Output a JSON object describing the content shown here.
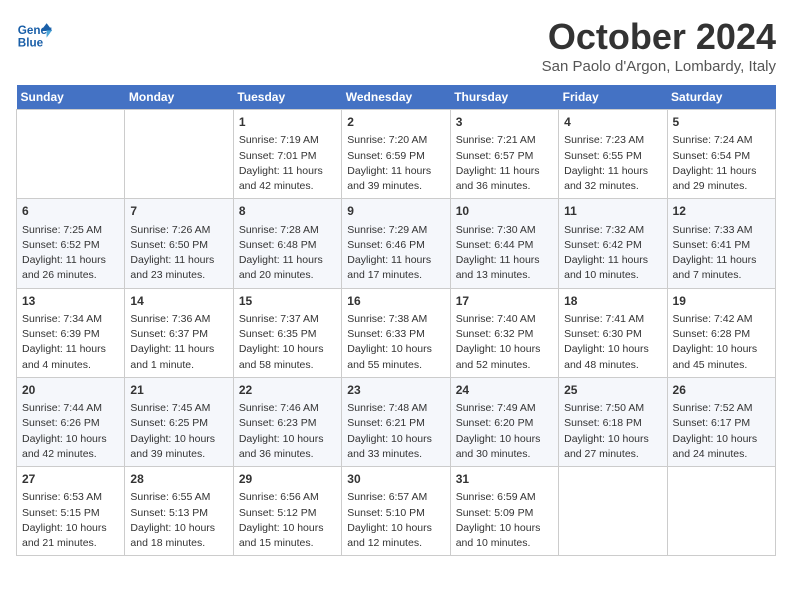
{
  "header": {
    "logo_line1": "General",
    "logo_line2": "Blue",
    "month": "October 2024",
    "location": "San Paolo d'Argon, Lombardy, Italy"
  },
  "weekdays": [
    "Sunday",
    "Monday",
    "Tuesday",
    "Wednesday",
    "Thursday",
    "Friday",
    "Saturday"
  ],
  "weeks": [
    [
      {
        "day": "",
        "sunrise": "",
        "sunset": "",
        "daylight": ""
      },
      {
        "day": "",
        "sunrise": "",
        "sunset": "",
        "daylight": ""
      },
      {
        "day": "1",
        "sunrise": "Sunrise: 7:19 AM",
        "sunset": "Sunset: 7:01 PM",
        "daylight": "Daylight: 11 hours and 42 minutes."
      },
      {
        "day": "2",
        "sunrise": "Sunrise: 7:20 AM",
        "sunset": "Sunset: 6:59 PM",
        "daylight": "Daylight: 11 hours and 39 minutes."
      },
      {
        "day": "3",
        "sunrise": "Sunrise: 7:21 AM",
        "sunset": "Sunset: 6:57 PM",
        "daylight": "Daylight: 11 hours and 36 minutes."
      },
      {
        "day": "4",
        "sunrise": "Sunrise: 7:23 AM",
        "sunset": "Sunset: 6:55 PM",
        "daylight": "Daylight: 11 hours and 32 minutes."
      },
      {
        "day": "5",
        "sunrise": "Sunrise: 7:24 AM",
        "sunset": "Sunset: 6:54 PM",
        "daylight": "Daylight: 11 hours and 29 minutes."
      }
    ],
    [
      {
        "day": "6",
        "sunrise": "Sunrise: 7:25 AM",
        "sunset": "Sunset: 6:52 PM",
        "daylight": "Daylight: 11 hours and 26 minutes."
      },
      {
        "day": "7",
        "sunrise": "Sunrise: 7:26 AM",
        "sunset": "Sunset: 6:50 PM",
        "daylight": "Daylight: 11 hours and 23 minutes."
      },
      {
        "day": "8",
        "sunrise": "Sunrise: 7:28 AM",
        "sunset": "Sunset: 6:48 PM",
        "daylight": "Daylight: 11 hours and 20 minutes."
      },
      {
        "day": "9",
        "sunrise": "Sunrise: 7:29 AM",
        "sunset": "Sunset: 6:46 PM",
        "daylight": "Daylight: 11 hours and 17 minutes."
      },
      {
        "day": "10",
        "sunrise": "Sunrise: 7:30 AM",
        "sunset": "Sunset: 6:44 PM",
        "daylight": "Daylight: 11 hours and 13 minutes."
      },
      {
        "day": "11",
        "sunrise": "Sunrise: 7:32 AM",
        "sunset": "Sunset: 6:42 PM",
        "daylight": "Daylight: 11 hours and 10 minutes."
      },
      {
        "day": "12",
        "sunrise": "Sunrise: 7:33 AM",
        "sunset": "Sunset: 6:41 PM",
        "daylight": "Daylight: 11 hours and 7 minutes."
      }
    ],
    [
      {
        "day": "13",
        "sunrise": "Sunrise: 7:34 AM",
        "sunset": "Sunset: 6:39 PM",
        "daylight": "Daylight: 11 hours and 4 minutes."
      },
      {
        "day": "14",
        "sunrise": "Sunrise: 7:36 AM",
        "sunset": "Sunset: 6:37 PM",
        "daylight": "Daylight: 11 hours and 1 minute."
      },
      {
        "day": "15",
        "sunrise": "Sunrise: 7:37 AM",
        "sunset": "Sunset: 6:35 PM",
        "daylight": "Daylight: 10 hours and 58 minutes."
      },
      {
        "day": "16",
        "sunrise": "Sunrise: 7:38 AM",
        "sunset": "Sunset: 6:33 PM",
        "daylight": "Daylight: 10 hours and 55 minutes."
      },
      {
        "day": "17",
        "sunrise": "Sunrise: 7:40 AM",
        "sunset": "Sunset: 6:32 PM",
        "daylight": "Daylight: 10 hours and 52 minutes."
      },
      {
        "day": "18",
        "sunrise": "Sunrise: 7:41 AM",
        "sunset": "Sunset: 6:30 PM",
        "daylight": "Daylight: 10 hours and 48 minutes."
      },
      {
        "day": "19",
        "sunrise": "Sunrise: 7:42 AM",
        "sunset": "Sunset: 6:28 PM",
        "daylight": "Daylight: 10 hours and 45 minutes."
      }
    ],
    [
      {
        "day": "20",
        "sunrise": "Sunrise: 7:44 AM",
        "sunset": "Sunset: 6:26 PM",
        "daylight": "Daylight: 10 hours and 42 minutes."
      },
      {
        "day": "21",
        "sunrise": "Sunrise: 7:45 AM",
        "sunset": "Sunset: 6:25 PM",
        "daylight": "Daylight: 10 hours and 39 minutes."
      },
      {
        "day": "22",
        "sunrise": "Sunrise: 7:46 AM",
        "sunset": "Sunset: 6:23 PM",
        "daylight": "Daylight: 10 hours and 36 minutes."
      },
      {
        "day": "23",
        "sunrise": "Sunrise: 7:48 AM",
        "sunset": "Sunset: 6:21 PM",
        "daylight": "Daylight: 10 hours and 33 minutes."
      },
      {
        "day": "24",
        "sunrise": "Sunrise: 7:49 AM",
        "sunset": "Sunset: 6:20 PM",
        "daylight": "Daylight: 10 hours and 30 minutes."
      },
      {
        "day": "25",
        "sunrise": "Sunrise: 7:50 AM",
        "sunset": "Sunset: 6:18 PM",
        "daylight": "Daylight: 10 hours and 27 minutes."
      },
      {
        "day": "26",
        "sunrise": "Sunrise: 7:52 AM",
        "sunset": "Sunset: 6:17 PM",
        "daylight": "Daylight: 10 hours and 24 minutes."
      }
    ],
    [
      {
        "day": "27",
        "sunrise": "Sunrise: 6:53 AM",
        "sunset": "Sunset: 5:15 PM",
        "daylight": "Daylight: 10 hours and 21 minutes."
      },
      {
        "day": "28",
        "sunrise": "Sunrise: 6:55 AM",
        "sunset": "Sunset: 5:13 PM",
        "daylight": "Daylight: 10 hours and 18 minutes."
      },
      {
        "day": "29",
        "sunrise": "Sunrise: 6:56 AM",
        "sunset": "Sunset: 5:12 PM",
        "daylight": "Daylight: 10 hours and 15 minutes."
      },
      {
        "day": "30",
        "sunrise": "Sunrise: 6:57 AM",
        "sunset": "Sunset: 5:10 PM",
        "daylight": "Daylight: 10 hours and 12 minutes."
      },
      {
        "day": "31",
        "sunrise": "Sunrise: 6:59 AM",
        "sunset": "Sunset: 5:09 PM",
        "daylight": "Daylight: 10 hours and 10 minutes."
      },
      {
        "day": "",
        "sunrise": "",
        "sunset": "",
        "daylight": ""
      },
      {
        "day": "",
        "sunrise": "",
        "sunset": "",
        "daylight": ""
      }
    ]
  ]
}
